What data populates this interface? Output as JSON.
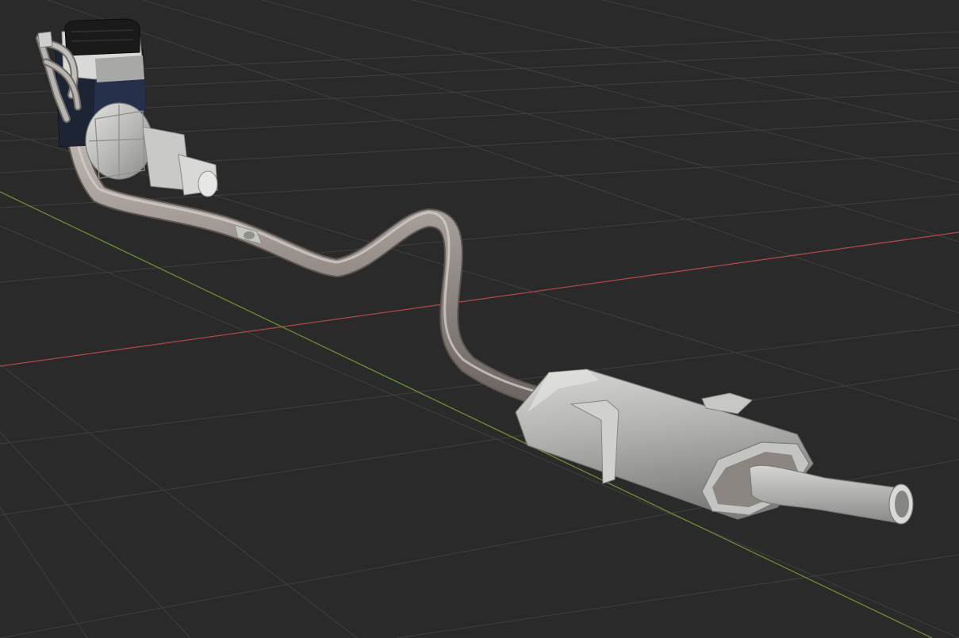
{
  "viewport": {
    "background_color": "#2a2a2a",
    "grid_color": "#3f3f3f",
    "x_axis_color": "#b04848",
    "y_axis_color": "#6e8f32"
  },
  "model": {
    "components": [
      "engine-block",
      "exhaust-manifold",
      "transmission",
      "exhaust-pipe",
      "pipe-clamp",
      "muffler",
      "tailpipe"
    ],
    "metal_color": "#bfc0bd",
    "pipe_color": "#9a918c",
    "engine_dark_color": "#1d2433",
    "engine_cover_color": "#1a1a1a"
  }
}
